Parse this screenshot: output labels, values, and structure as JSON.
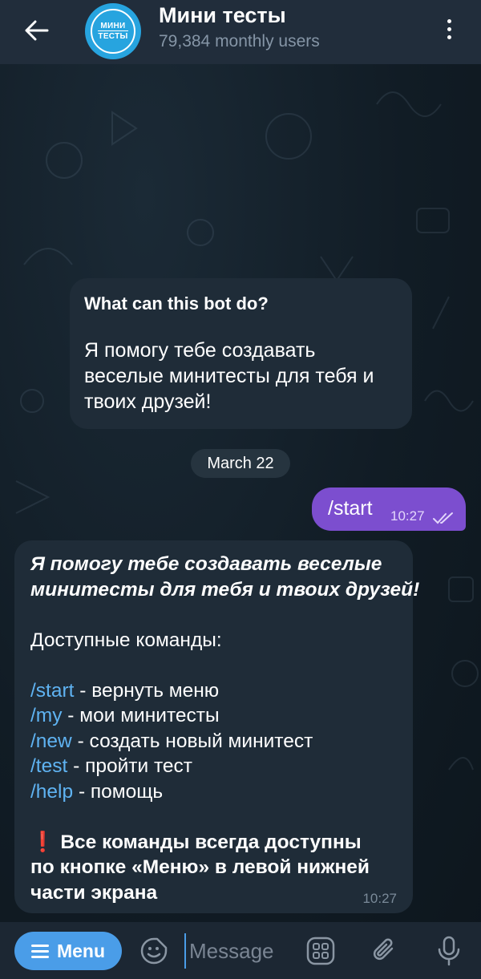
{
  "header": {
    "title": "Мини тесты",
    "subtitle": "79,384 monthly users",
    "avatar_line1": "МИНИ",
    "avatar_line2": "ТЕСТЫ",
    "back_icon": "arrow-left",
    "more_icon": "vertical-dots"
  },
  "info_message": {
    "title": "What can this bot do?",
    "text_lines": [
      "Я помогу тебе создавать",
      "веселые минитесты для тебя и",
      "твоих друзей!"
    ]
  },
  "date_separator": "March 22",
  "outgoing_message": {
    "text": "/start",
    "time": "10:27",
    "status_icon": "double-check"
  },
  "bot_message": {
    "intro_lines": [
      "Я помогу тебе создавать веселые",
      "минитесты для тебя и твоих друзей!"
    ],
    "commands_heading": "Доступные команды:",
    "commands": [
      {
        "command": "/start",
        "description": " - вернуть меню"
      },
      {
        "command": "/my",
        "description": " - мои минитесты"
      },
      {
        "command": "/new",
        "description": " - создать новый минитест"
      },
      {
        "command": "/test",
        "description": " - пройти тест"
      },
      {
        "command": "/help",
        "description": " - помощь"
      }
    ],
    "note_mark": "❗",
    "note_lines": [
      "Все команды всегда доступны",
      "по кнопке «Меню» в левой нижней",
      "части экрана"
    ],
    "time": "10:27"
  },
  "composer": {
    "menu_label": "Menu",
    "placeholder": "Message",
    "icons": [
      "sticker-icon",
      "bot-app-grid-icon",
      "attach-icon",
      "microphone-icon"
    ]
  },
  "colors": {
    "header_bg": "#212d3b",
    "bubble_bg": "#1f2c38",
    "outgoing_bg": "#7c4ecf",
    "link": "#5fb3f2",
    "menu_button": "#4a9de8"
  }
}
